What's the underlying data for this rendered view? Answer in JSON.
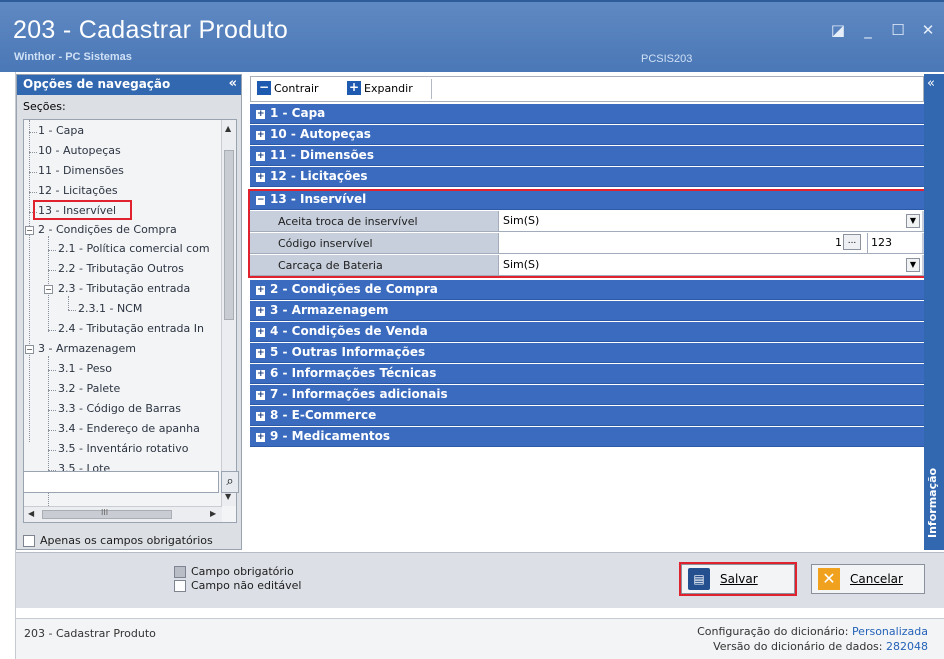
{
  "window": {
    "title": "203 - Cadastrar  Produto",
    "subtitle": "Winthor - PC Sistemas",
    "code": "PCSIS203"
  },
  "nav": {
    "header": "Opções de navegação",
    "secoes_label": "Seções:",
    "tree": [
      "1 - Capa",
      "10 - Autopeças",
      "11 - Dimensões",
      "12 - Licitações",
      "13 - Inservível",
      "2 - Condições de Compra",
      "2.1 - Política comercial com",
      "2.2 - Tributação Outros",
      "2.3 - Tributação entrada",
      "2.3.1 - NCM",
      "2.4 - Tributação entrada In",
      "3 - Armazenagem",
      "3.1 - Peso",
      "3.2 - Palete",
      "3.3 - Código de Barras",
      "3.4 - Endereço de apanha",
      "3.5 - Inventário rotativo",
      "3.5 - Lote"
    ],
    "hscroll_mid": "III",
    "only_required_label": "Apenas os campos obrigatórios"
  },
  "toolbar": {
    "collapse_label": "Contrair",
    "expand_label": "Expandir"
  },
  "grid": {
    "sections_top": [
      "1 - Capa",
      "10 - Autopeças",
      "11 - Dimensões",
      "12 - Licitações"
    ],
    "expanded_section": "13 - Inservível",
    "properties": [
      {
        "label": "Aceita troca de inservível",
        "value": "Sim(S)"
      },
      {
        "label": "Código inservível",
        "num": "1",
        "btn": "...",
        "value": "123"
      },
      {
        "label": "Carcaça de Bateria",
        "value": "Sim(S)"
      }
    ],
    "sections_bottom": [
      "2 - Condições de Compra",
      "3 - Armazenagem",
      "4 - Condições de Venda",
      "5 - Outras Informações",
      "6 - Informações Técnicas",
      "7 - Informações adicionais",
      "8 - E-Commerce",
      "9 - Medicamentos"
    ]
  },
  "rightbar": {
    "label": "Informação"
  },
  "legend": {
    "required": "Campo obrigatório",
    "not_editable": "Campo não editável"
  },
  "buttons": {
    "save": "Salvar",
    "cancel": "Cancelar"
  },
  "status": {
    "left": "203 - Cadastrar  Produto",
    "config_label": "Configuração do dicionário:",
    "config_value": "Personalizada",
    "version_label": "Versão do dicionário de dados:",
    "version_value": "282048"
  },
  "colors": {
    "title_bg": "#4a77b6",
    "section_bg": "#3a6bbf",
    "highlight": "#e0222e"
  }
}
